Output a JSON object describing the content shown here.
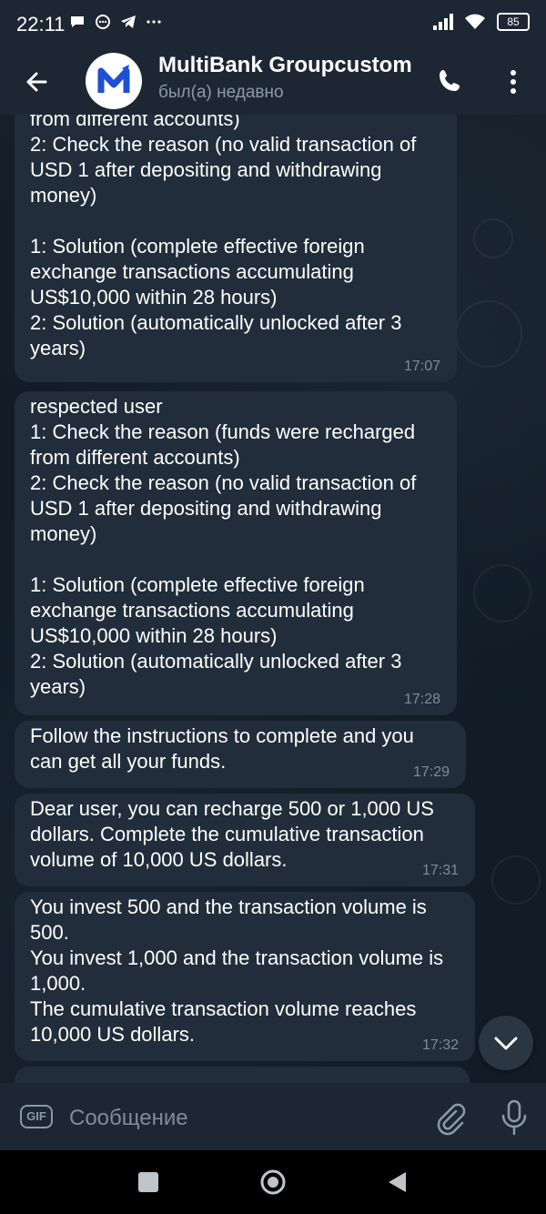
{
  "status_bar": {
    "time": "22:11",
    "battery": "85",
    "icons": [
      "chat-bubble-icon",
      "messenger-icon",
      "telegram-icon",
      "more-dots-icon",
      "signal-icon",
      "wifi-icon",
      "battery-icon"
    ]
  },
  "header": {
    "title": "MultiBank Groupcustom",
    "status": "был(а) недавно",
    "avatar_letter": "M"
  },
  "messages": [
    {
      "text": "from different accounts)\n2: Check the reason (no valid transaction of USD 1 after depositing and withdrawing money)\n\n1: Solution (complete effective foreign exchange transactions accumulating US$10,000 within 28 hours)\n2: Solution (automatically unlocked after 3 years)",
      "time": "17:07"
    },
    {
      "text": "respected user\n1: Check the reason (funds were recharged from different accounts)\n2: Check the reason (no valid transaction of USD 1 after depositing and withdrawing money)\n\n1: Solution (complete effective foreign exchange transactions accumulating US$10,000 within 28 hours)\n2: Solution (automatically unlocked after 3 years)",
      "time": "17:28"
    },
    {
      "text": "Follow the instructions to complete and you can get all your funds.",
      "time": "17:29"
    },
    {
      "text": "Dear user, you can recharge 500 or 1,000 US dollars. Complete the cumulative transaction volume of 10,000 US dollars.",
      "time": "17:31"
    },
    {
      "text": "You invest 500 and the transaction volume is 500.\nYou invest 1,000 and the transaction volume is 1,000.\nThe cumulative transaction volume reaches 10,000 US dollars.",
      "time": "17:32"
    }
  ],
  "composer": {
    "gif_label": "GIF",
    "placeholder": "Сообщение"
  },
  "colors": {
    "background": "#0e1621",
    "bar": "#1d2733",
    "bubble": "#212d3b",
    "time_text": "#7d8b99",
    "avatar_blue": "#1f4fd6"
  }
}
